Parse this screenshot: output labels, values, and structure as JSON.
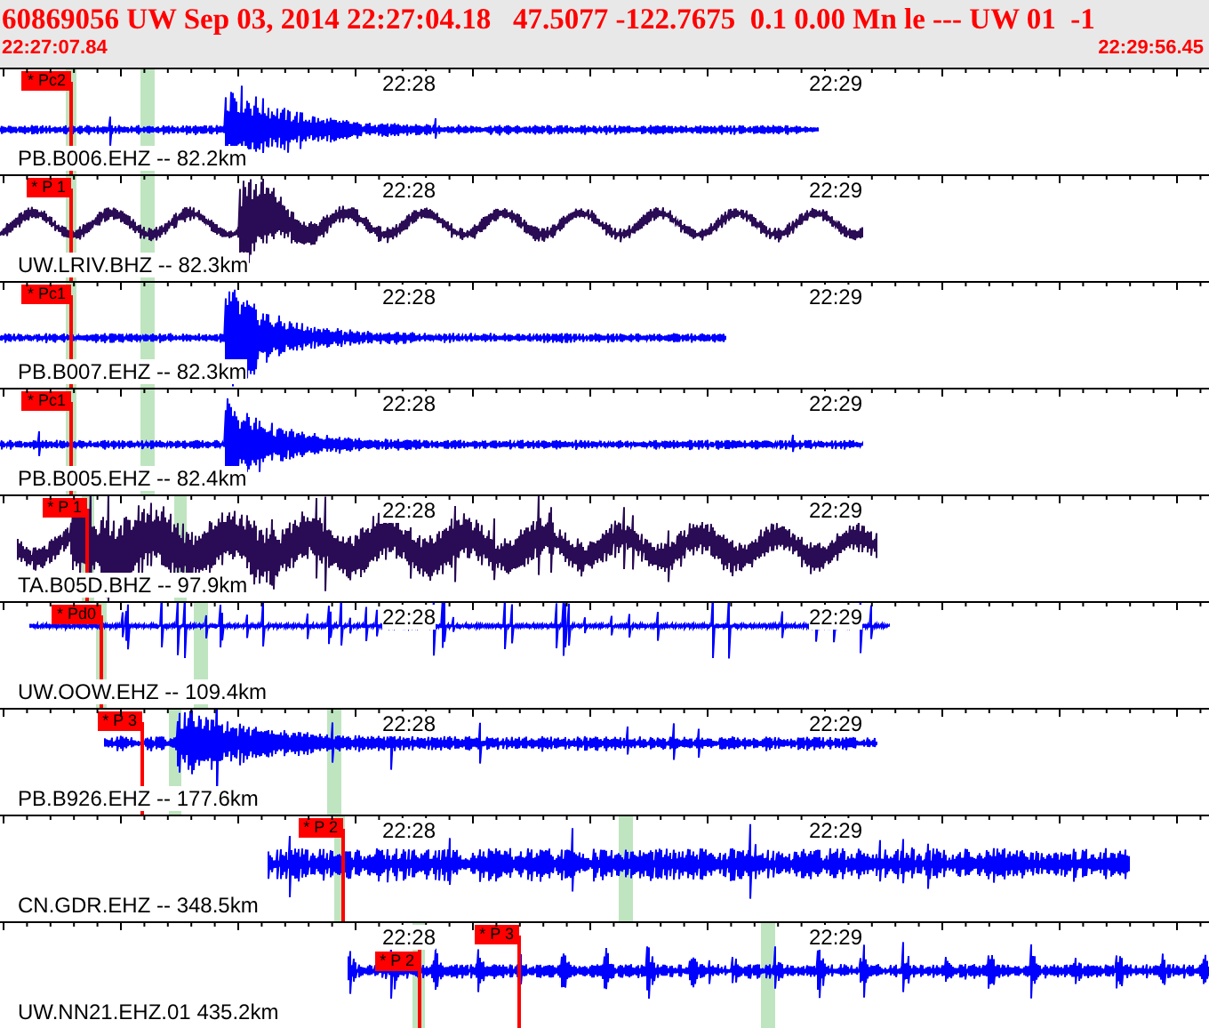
{
  "event": {
    "summary": "60869056 UW Sep 03, 2014 22:27:04.18   47.5077 -122.7675  0.1 0.00 Mn le --- UW 01  -1",
    "start_time": "22:27:07.84",
    "end_time": "22:29:56.45"
  },
  "traces": [
    {
      "station": "PB.B006.EHZ -- 82.2km",
      "color": "#0000ff",
      "time_labels": [
        "22:28",
        "22:29"
      ],
      "picks": [
        "* Pc2"
      ]
    },
    {
      "station": "UW.LRIV.BHZ -- 82.3km",
      "color": "#2a0b55",
      "time_labels": [
        "22:28",
        "22:29"
      ],
      "picks": [
        "* P 1"
      ]
    },
    {
      "station": "PB.B007.EHZ -- 82.3km",
      "color": "#0000ff",
      "time_labels": [
        "22:28",
        "22:29"
      ],
      "picks": [
        "* Pc1"
      ]
    },
    {
      "station": "PB.B005.EHZ -- 82.4km",
      "color": "#0000ff",
      "time_labels": [
        "22:28",
        "22:29"
      ],
      "picks": [
        "* Pc1"
      ]
    },
    {
      "station": "TA.B05D.BHZ -- 97.9km",
      "color": "#2a0b55",
      "time_labels": [
        "22:28",
        "22:29"
      ],
      "picks": [
        "* P 1"
      ]
    },
    {
      "station": "UW.OOW.EHZ -- 109.4km",
      "color": "#0000ff",
      "time_labels": [
        "22:28",
        "22:29"
      ],
      "picks": [
        "* Pd0"
      ]
    },
    {
      "station": "PB.B926.EHZ -- 177.6km",
      "color": "#0000ff",
      "time_labels": [
        "22:28",
        "22:29"
      ],
      "picks": [
        "* P 3"
      ]
    },
    {
      "station": "CN.GDR.EHZ -- 348.5km",
      "color": "#0000ff",
      "time_labels": [
        "22:28",
        "22:29"
      ],
      "picks": [
        "* P 2"
      ]
    },
    {
      "station": "UW.NN21.EHZ.01 435.2km",
      "color": "#0000ff",
      "time_labels": [
        "22:28",
        "22:29"
      ],
      "picks": [
        "* P 2",
        "* P 3"
      ]
    }
  ]
}
